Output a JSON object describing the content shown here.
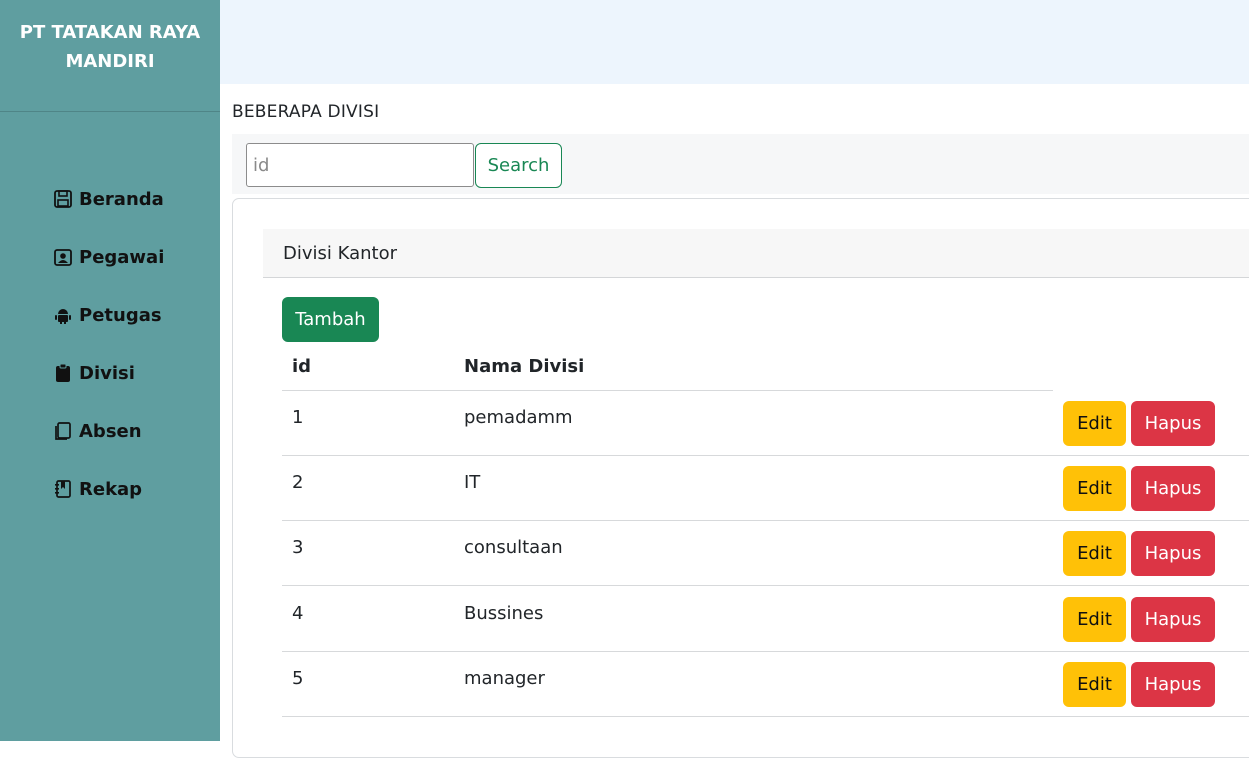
{
  "sidebar": {
    "brand_line1": "PT TATAKAN RAYA",
    "brand_line2": "MANDIRI",
    "items": [
      {
        "label": "Beranda",
        "icon": "save-icon"
      },
      {
        "label": "Pegawai",
        "icon": "person-badge-icon"
      },
      {
        "label": "Petugas",
        "icon": "android-icon"
      },
      {
        "label": "Divisi",
        "icon": "clipboard-icon"
      },
      {
        "label": "Absen",
        "icon": "journals-icon"
      },
      {
        "label": "Rekap",
        "icon": "journal-bookmark-icon"
      }
    ]
  },
  "main": {
    "page_title": "BEBERAPA DIVISI",
    "search": {
      "placeholder": "id",
      "value": "",
      "button_label": "Search"
    },
    "card": {
      "title": "Divisi Kantor",
      "add_label": "Tambah",
      "columns": [
        "id",
        "Nama Divisi"
      ],
      "rows": [
        {
          "id": "1",
          "name": "pemadamm"
        },
        {
          "id": "2",
          "name": "IT"
        },
        {
          "id": "3",
          "name": "consultaan"
        },
        {
          "id": "4",
          "name": "Bussines"
        },
        {
          "id": "5",
          "name": "manager"
        }
      ],
      "edit_label": "Edit",
      "delete_label": "Hapus"
    }
  },
  "colors": {
    "sidebar_bg": "#5f9ea0",
    "topbar_bg": "#edf5fd",
    "success": "#198754",
    "warning": "#ffc107",
    "danger": "#dc3545"
  }
}
